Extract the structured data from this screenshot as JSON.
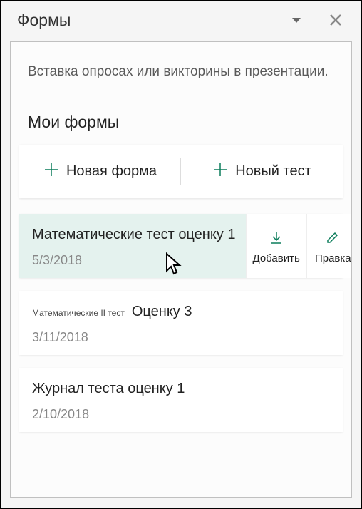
{
  "header": {
    "title": "Формы"
  },
  "description": "Вставка опросах или викторины в презентации.",
  "section_title": "Мои формы",
  "create": {
    "new_form": "Новая форма",
    "new_test": "Новый тест"
  },
  "actions": {
    "add": "Добавить",
    "edit": "Правка"
  },
  "forms": [
    {
      "title": "Математические тест оценку 1",
      "date": "5/3/2018",
      "hovered": true
    },
    {
      "prefix": "Математические II тест",
      "title": "Оценку 3",
      "date": "3/11/2018",
      "hovered": false
    },
    {
      "title": "Журнал теста оценку 1",
      "date": "2/10/2018",
      "hovered": false
    }
  ]
}
